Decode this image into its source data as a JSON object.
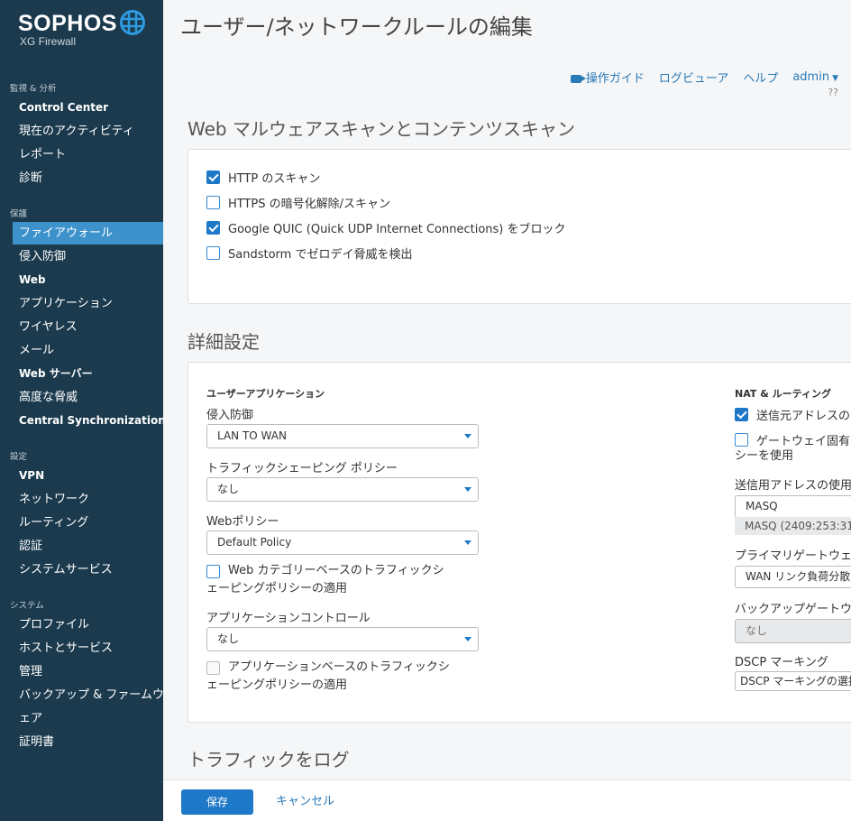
{
  "brand": {
    "name": "SOPHOS",
    "product": "XG Firewall"
  },
  "sidebar": {
    "sections": [
      {
        "label": "監視 & 分析"
      },
      {
        "label": "保護"
      },
      {
        "label": "設定"
      },
      {
        "label": "システム"
      }
    ],
    "items": [
      {
        "label": "Control Center"
      },
      {
        "label": "現在のアクティビティ"
      },
      {
        "label": "レポート"
      },
      {
        "label": "診断"
      },
      {
        "label": "ファイアウォール"
      },
      {
        "label": "侵入防御"
      },
      {
        "label": "Web"
      },
      {
        "label": "アプリケーション"
      },
      {
        "label": "ワイヤレス"
      },
      {
        "label": "メール"
      },
      {
        "label": "Web サーバー"
      },
      {
        "label": "高度な脅威"
      },
      {
        "label": "Central Synchronization"
      },
      {
        "label": "VPN"
      },
      {
        "label": "ネットワーク"
      },
      {
        "label": "ルーティング"
      },
      {
        "label": "認証"
      },
      {
        "label": "システムサービス"
      },
      {
        "label": "プロファイル"
      },
      {
        "label": "ホストとサービス"
      },
      {
        "label": "管理"
      },
      {
        "label": "バックアップ & ファームウ"
      },
      {
        "label": "ェア"
      },
      {
        "label": "証明書"
      }
    ]
  },
  "header": {
    "title": "ユーザー/ネットワークルールの編集",
    "links": {
      "guide": "操作ガイド",
      "log_viewer": "ログビューア",
      "help": "ヘルプ",
      "user": "admin"
    },
    "extra": "??"
  },
  "web_scan": {
    "title": "Web マルウェアスキャンとコンテンツスキャン",
    "options": [
      {
        "label": "HTTP のスキャン",
        "checked": true
      },
      {
        "label": "HTTPS の暗号化解除/スキャン",
        "checked": false
      },
      {
        "label": "Google QUIC (Quick UDP Internet Connections) をブロック",
        "checked": true
      },
      {
        "label": "Sandstorm でゼロデイ脅威を検出",
        "checked": false
      }
    ]
  },
  "advanced": {
    "title": "詳細設定",
    "user_apps": {
      "heading": "ユーザーアプリケーション",
      "ips_label": "侵入防御",
      "ips_value": "LAN TO WAN",
      "shaping_label": "トラフィックシェーピング ポリシー",
      "shaping_value": "なし",
      "web_policy_label": "Webポリシー",
      "web_policy_value": "Default Policy",
      "web_cat_line1": "Web カテゴリーベースのトラフィックシ",
      "web_cat_line2": "ェーピングポリシーの適用",
      "app_control_label": "アプリケーションコントロール",
      "app_control_value": "なし",
      "app_based_line1": "アプリケーションベースのトラフィックシ",
      "app_based_line2": "ェーピングポリシーの適用"
    },
    "nat": {
      "heading": "NAT & ルーティング",
      "masq_label": "送信元アドレスの",
      "gateway_line1": "ゲートウェイ固有",
      "gateway_line2": "シーを使用",
      "outbound_label": "送信用アドレスの使用",
      "outbound_value": "MASQ",
      "outbound_hint": "MASQ (2409:253:31",
      "primary_gw_label": "プライマリゲートウェ",
      "primary_gw_value": "WAN リンク負荷分散",
      "backup_gw_label": "バックアップゲートウ",
      "backup_gw_value": "なし",
      "dscp_label": "DSCP マーキング",
      "dscp_value": "DSCP マーキングの選択"
    }
  },
  "log_section": {
    "title": "トラフィックをログ"
  },
  "footer": {
    "save": "保存",
    "cancel": "キャンセル"
  }
}
